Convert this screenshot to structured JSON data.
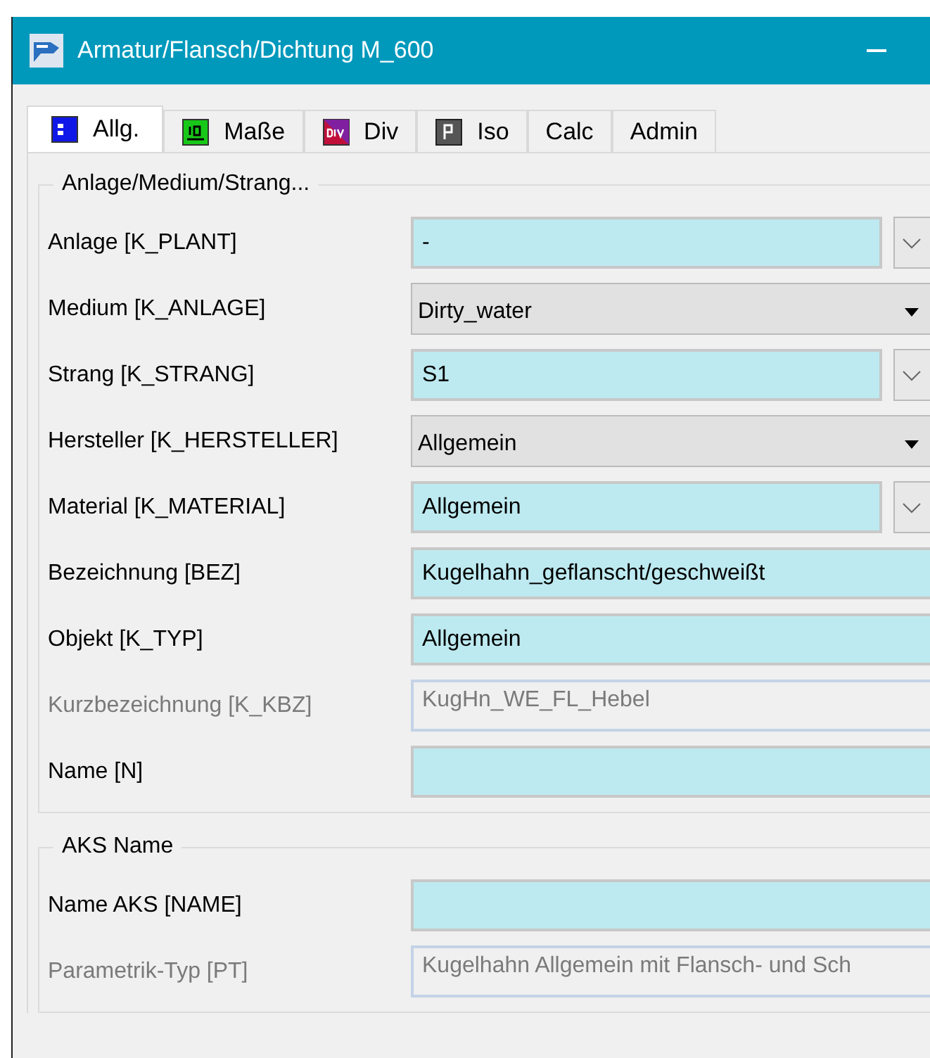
{
  "window": {
    "title": "Armatur/Flansch/Dichtung M_600"
  },
  "tabs": [
    {
      "label": "Allg.",
      "selected": true
    },
    {
      "label": "Maße",
      "selected": false
    },
    {
      "label": "Div",
      "selected": false
    },
    {
      "label": "Iso",
      "selected": false
    },
    {
      "label": "Calc",
      "selected": false
    },
    {
      "label": "Admin",
      "selected": false
    }
  ],
  "groups": [
    {
      "title": "Anlage/Medium/Strang...",
      "fields": [
        {
          "label": "Anlage [K_PLANT]",
          "kind": "picker",
          "value": "-"
        },
        {
          "label": "Medium [K_ANLAGE]",
          "kind": "combo",
          "value": "Dirty_water"
        },
        {
          "label": "Strang [K_STRANG]",
          "kind": "picker",
          "value": "S1"
        },
        {
          "label": "Hersteller [K_HERSTELLER]",
          "kind": "combo",
          "value": "Allgemein"
        },
        {
          "label": "Material [K_MATERIAL]",
          "kind": "picker",
          "value": "Allgemein"
        },
        {
          "label": "Bezeichnung [BEZ]",
          "kind": "input",
          "value": "Kugelhahn_geflanscht/geschweißt"
        },
        {
          "label": "Objekt [K_TYP]",
          "kind": "input",
          "value": "Allgemein"
        },
        {
          "label": "Kurzbezeichnung [K_KBZ]",
          "kind": "readonly",
          "value": "KugHn_WE_FL_Hebel"
        },
        {
          "label": "Name [N]",
          "kind": "input"
        }
      ]
    },
    {
      "title": "AKS Name",
      "fields": [
        {
          "label": "Name AKS [NAME]",
          "kind": "input"
        },
        {
          "label": "Parametrik-Typ [PT]",
          "kind": "readonly",
          "value": "Kugelhahn Allgemein mit Flansch- und Sch"
        }
      ]
    }
  ]
}
